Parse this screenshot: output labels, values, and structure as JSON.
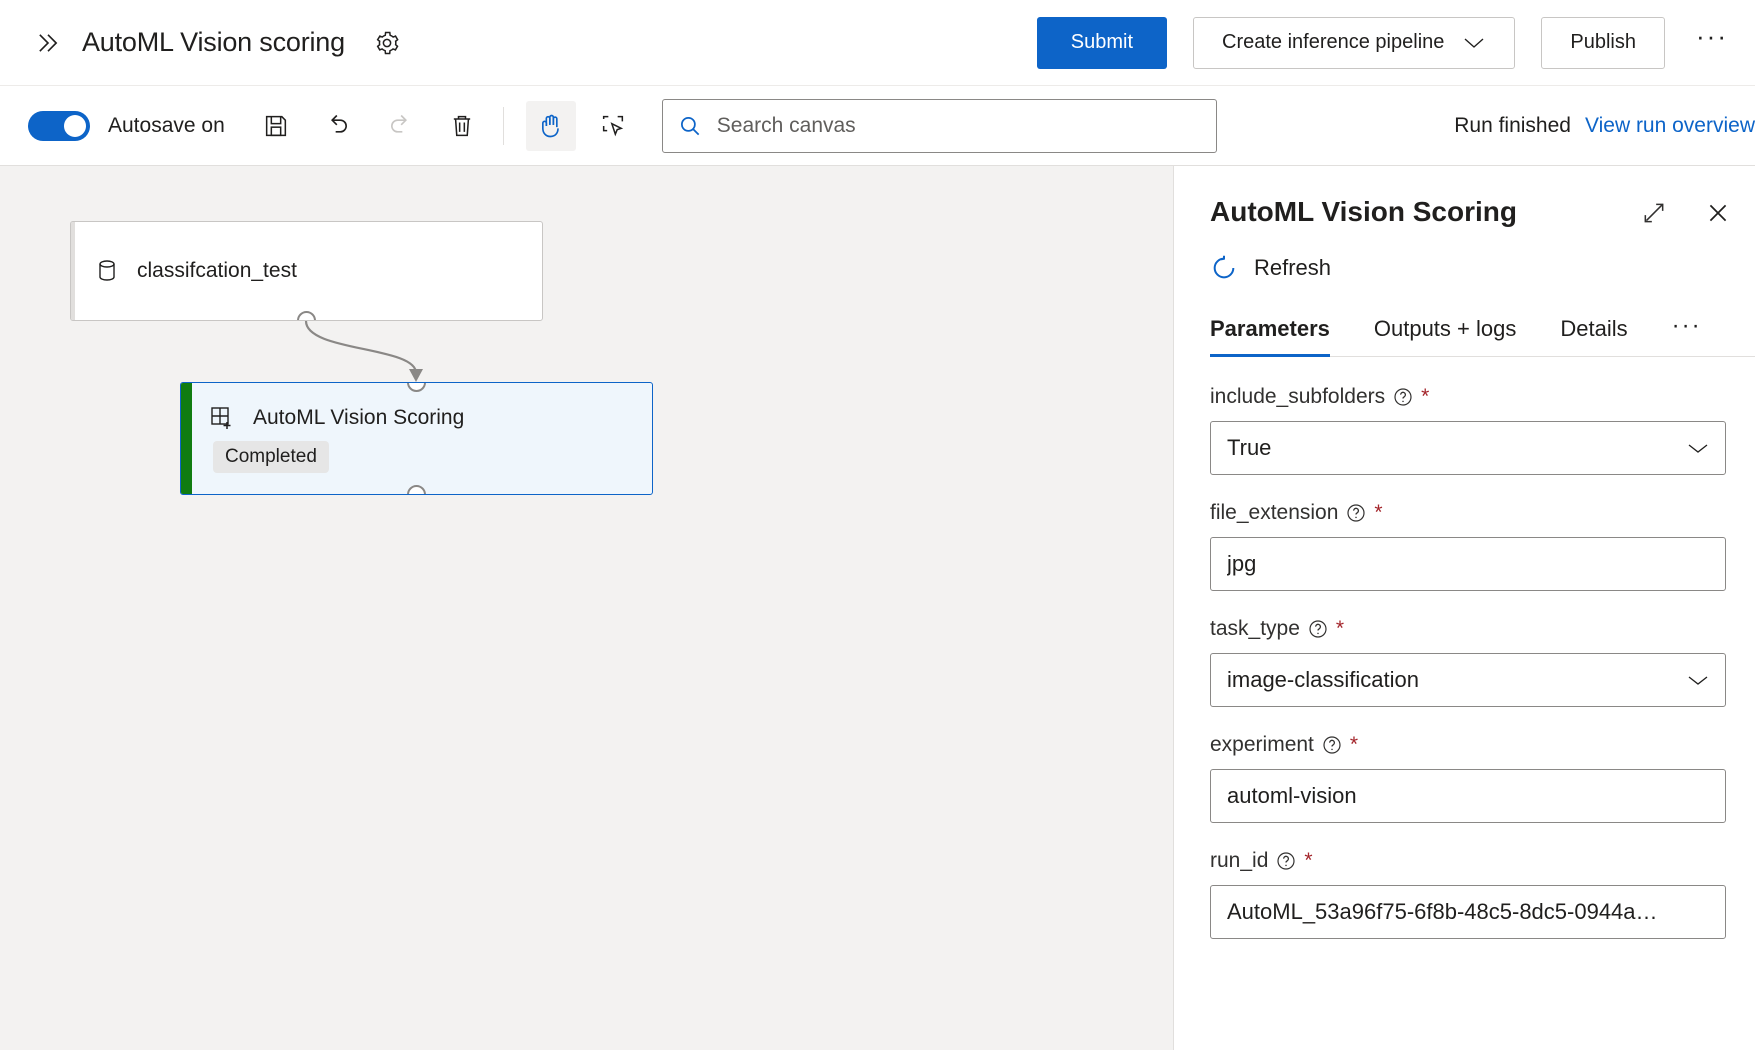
{
  "header": {
    "expand_icon": "chevron-double-right-icon",
    "title": "AutoML Vision scoring",
    "settings_icon": "gear-icon",
    "submit_label": "Submit",
    "create_inference_label": "Create inference pipeline",
    "publish_label": "Publish",
    "overflow_label": "···"
  },
  "toolbar": {
    "autosave_label": "Autosave on",
    "autosave_on": true,
    "save_icon": "save-icon",
    "undo_icon": "undo-icon",
    "redo_icon": "redo-icon",
    "delete_icon": "trash-icon",
    "pan_icon": "hand-pan-icon",
    "select_icon": "marquee-select-icon",
    "search_icon": "search-icon",
    "search_placeholder": "Search canvas",
    "search_value": "",
    "run_status": "Run finished",
    "run_link": "View run overview"
  },
  "canvas": {
    "nodes": [
      {
        "name": "classifcation_test",
        "icon": "database-icon",
        "type": "dataset"
      },
      {
        "name": "AutoML Vision Scoring",
        "icon": "module-grid-plus-icon",
        "type": "module",
        "status": "Completed",
        "status_color": "#107c10",
        "selected": true
      }
    ]
  },
  "panel": {
    "title": "AutoML Vision Scoring",
    "expand_icon": "expand-diagonal-icon",
    "close_icon": "close-icon",
    "refresh_label": "Refresh",
    "refresh_icon": "refresh-icon",
    "tabs": [
      {
        "label": "Parameters",
        "active": true
      },
      {
        "label": "Outputs + logs",
        "active": false
      },
      {
        "label": "Details",
        "active": false
      }
    ],
    "tabs_overflow": "···",
    "fields": [
      {
        "label": "include_subfolders",
        "value": "True",
        "control": "dropdown",
        "required": "*",
        "help_icon": "help-circle-icon"
      },
      {
        "label": "file_extension",
        "value": "jpg",
        "control": "text",
        "required": "*",
        "help_icon": "help-circle-icon"
      },
      {
        "label": "task_type",
        "value": "image-classification",
        "control": "dropdown",
        "required": "*",
        "help_icon": "help-circle-icon"
      },
      {
        "label": "experiment",
        "value": "automl-vision",
        "control": "text",
        "required": "*",
        "help_icon": "help-circle-icon"
      },
      {
        "label": "run_id",
        "value": "AutoML_53a96f75-6f8b-48c5-8dc5-0944a…",
        "control": "text",
        "required": "*",
        "help_icon": "help-circle-icon"
      }
    ]
  },
  "colors": {
    "accent": "#0d64c8",
    "success": "#107c10",
    "required": "#a4262c",
    "canvas_bg": "#f3f2f1",
    "node_selected_bg": "#eff6fc"
  }
}
